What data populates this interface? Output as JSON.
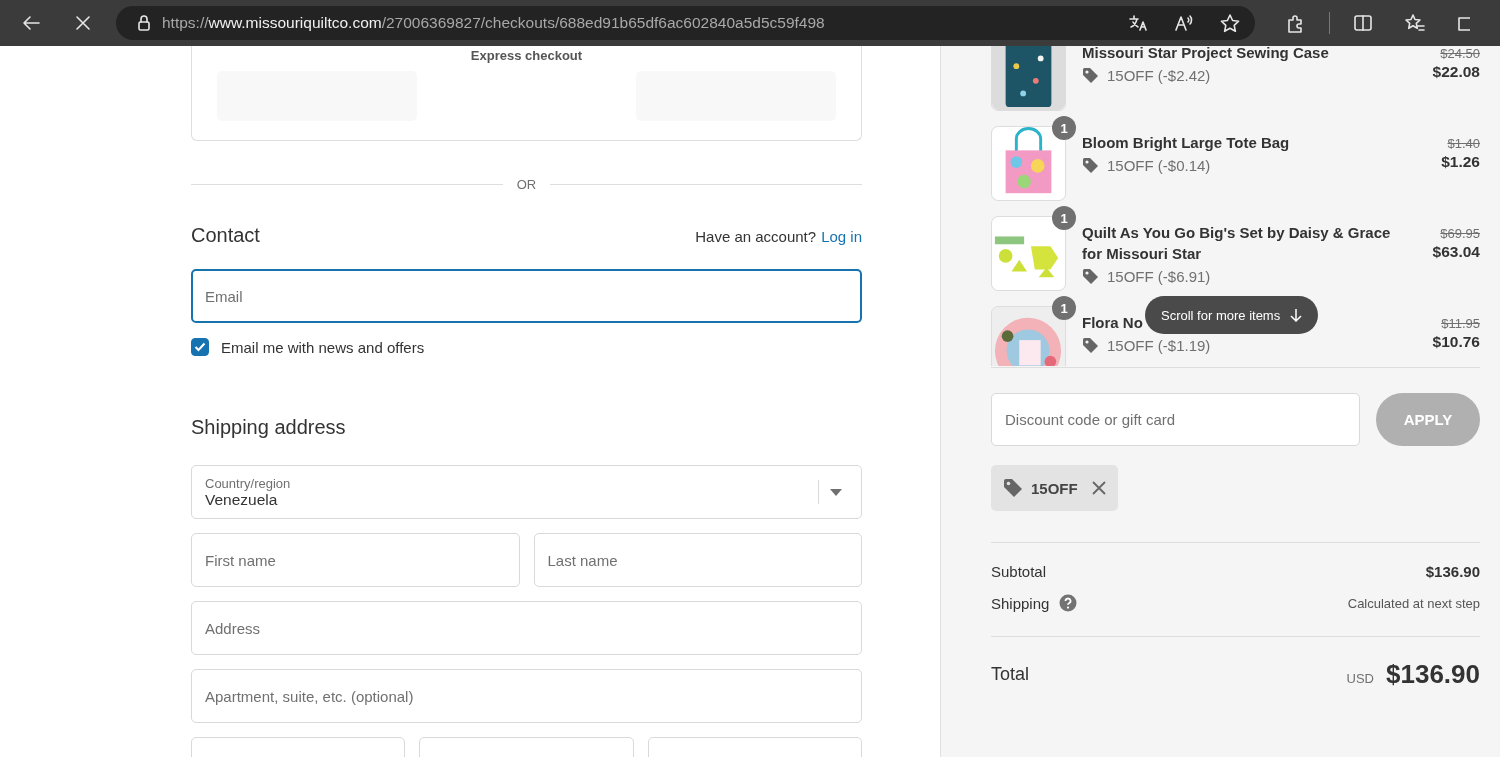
{
  "browser": {
    "url": "https://**www.missouriquiltco.com**/27006369827/checkouts/688ed91b65df6ac602840a5d5c59f498",
    "loading": true
  },
  "checkout": {
    "express": {
      "title": "Express checkout"
    },
    "divider_text": "OR",
    "contact": {
      "heading": "Contact",
      "account_prompt": "Have an account?",
      "login_link": "Log in",
      "email": {
        "placeholder": "Email",
        "focused": true
      },
      "marketing": {
        "label": "Email me with news and offers",
        "checked": true
      }
    },
    "shipping": {
      "heading": "Shipping address",
      "country": {
        "label": "Country/region",
        "value": "Venezuela"
      },
      "field_rows": [
        [
          {
            "placeholder": "First name"
          },
          {
            "placeholder": "Last name"
          }
        ],
        [
          {
            "placeholder": "Address"
          }
        ],
        [
          {
            "placeholder": "Apartment, suite, etc. (optional)"
          }
        ],
        [
          {},
          {},
          {}
        ]
      ]
    }
  },
  "summary": {
    "items": [
      {
        "title": "Missouri Star Project Sewing Case",
        "discount": "15OFF (-$2.42)",
        "original_price": "$24.50",
        "price": "$22.08"
      },
      {
        "title": "Bloom Bright Large Tote Bag",
        "quantity": "1",
        "discount": "15OFF (-$0.14)",
        "original_price": "$1.40",
        "price": "$1.26"
      },
      {
        "title": "Quilt As You Go Big's Set by Daisy & Grace for Missouri Star",
        "quantity": "1",
        "discount": "15OFF (-$6.91)",
        "original_price": "$69.95",
        "price": "$63.04"
      },
      {
        "title": "Flora No",
        "quantity": "1",
        "discount": "15OFF (-$1.19)",
        "original_price": "$11.95",
        "price": "$10.76"
      }
    ],
    "scroll_hint": "Scroll for more items",
    "discount": {
      "placeholder": "Discount code or gift card",
      "apply_label": "APPLY",
      "apply_disabled": true
    },
    "applied_codes": [
      {
        "code": "15OFF"
      }
    ],
    "subtotal": {
      "label": "Subtotal",
      "value": "$136.90"
    },
    "shipping": {
      "label": "Shipping",
      "value": "Calculated at next step"
    },
    "total": {
      "label": "Total",
      "currency": "USD",
      "value": "$136.90"
    }
  }
}
